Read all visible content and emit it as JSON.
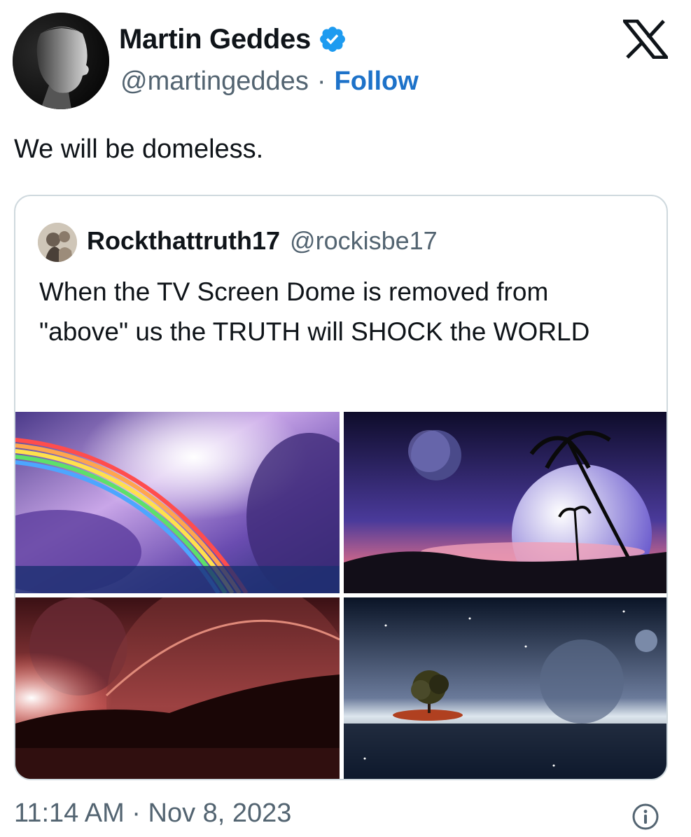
{
  "author": {
    "display_name": "Martin Geddes",
    "handle": "@martingeddes",
    "separator": "·",
    "follow_label": "Follow",
    "verified_color": "#1d9bf0"
  },
  "brand": {
    "icon": "x-logo-icon"
  },
  "tweet": {
    "text": "We will be domeless."
  },
  "quoted_tweet": {
    "display_name": "Rockthattruth17",
    "handle": "@rockisbe17",
    "text": "When the TV Screen Dome is removed from \"above\" us the TRUTH will SHOCK the WORLD",
    "images": [
      {
        "icon": "rainbow-sky-image"
      },
      {
        "icon": "planets-palm-beach-image"
      },
      {
        "icon": "red-planet-sunset-image"
      },
      {
        "icon": "tree-island-galaxy-image"
      }
    ]
  },
  "footer": {
    "timestamp": "11:14 AM · Nov 8, 2023",
    "info_icon": "info-icon"
  },
  "colors": {
    "link": "#1d72c9",
    "secondary_text": "#536471",
    "primary_text": "#0f1419",
    "border": "#cfd9de"
  }
}
